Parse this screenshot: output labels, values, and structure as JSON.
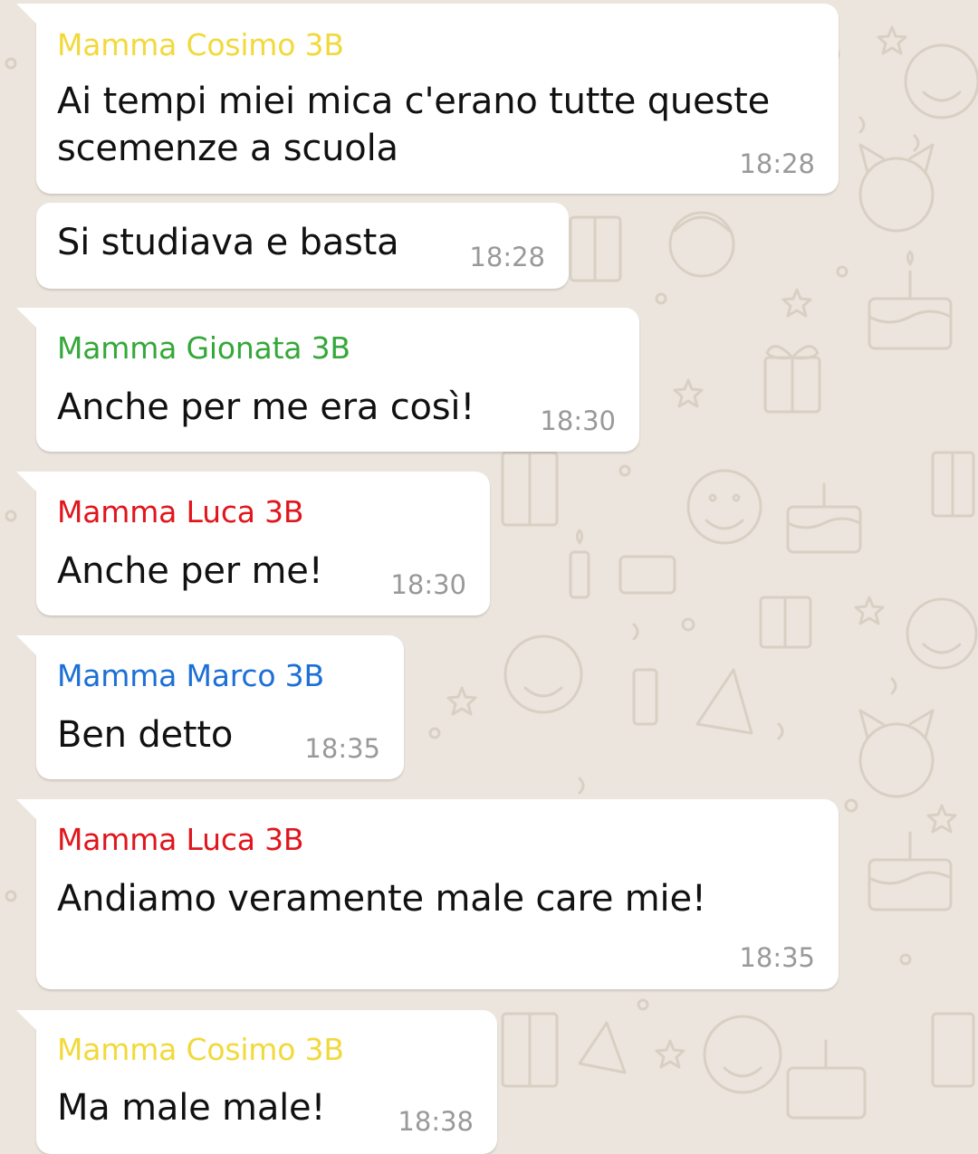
{
  "chat": {
    "colors": {
      "background": "#ece5dd",
      "bubble": "#ffffff",
      "timestamp": "#999999",
      "sender_cosimo": "#f2d93b",
      "sender_gionata": "#35a83a",
      "sender_luca": "#e0161c",
      "sender_marco": "#1c6fd6"
    },
    "messages": [
      {
        "sender": "Mamma Cosimo 3B",
        "lines": [
          "Ai tempi miei mica c'erano tutte queste",
          "scemenze a scuola"
        ],
        "time": "18:28"
      },
      {
        "sender": "",
        "lines": [
          "Si studiava e basta"
        ],
        "time": "18:28"
      },
      {
        "sender": "Mamma Gionata 3B",
        "lines": [
          "Anche per me era così!"
        ],
        "time": "18:30"
      },
      {
        "sender": "Mamma Luca 3B",
        "lines": [
          "Anche per me!"
        ],
        "time": "18:30"
      },
      {
        "sender": "Mamma Marco 3B",
        "lines": [
          "Ben detto"
        ],
        "time": "18:35"
      },
      {
        "sender": "Mamma Luca 3B",
        "lines": [
          "Andiamo veramente male care mie!"
        ],
        "time": "18:35"
      },
      {
        "sender": "Mamma Cosimo 3B",
        "lines": [
          "Ma male male!"
        ],
        "time": "18:38"
      }
    ]
  }
}
